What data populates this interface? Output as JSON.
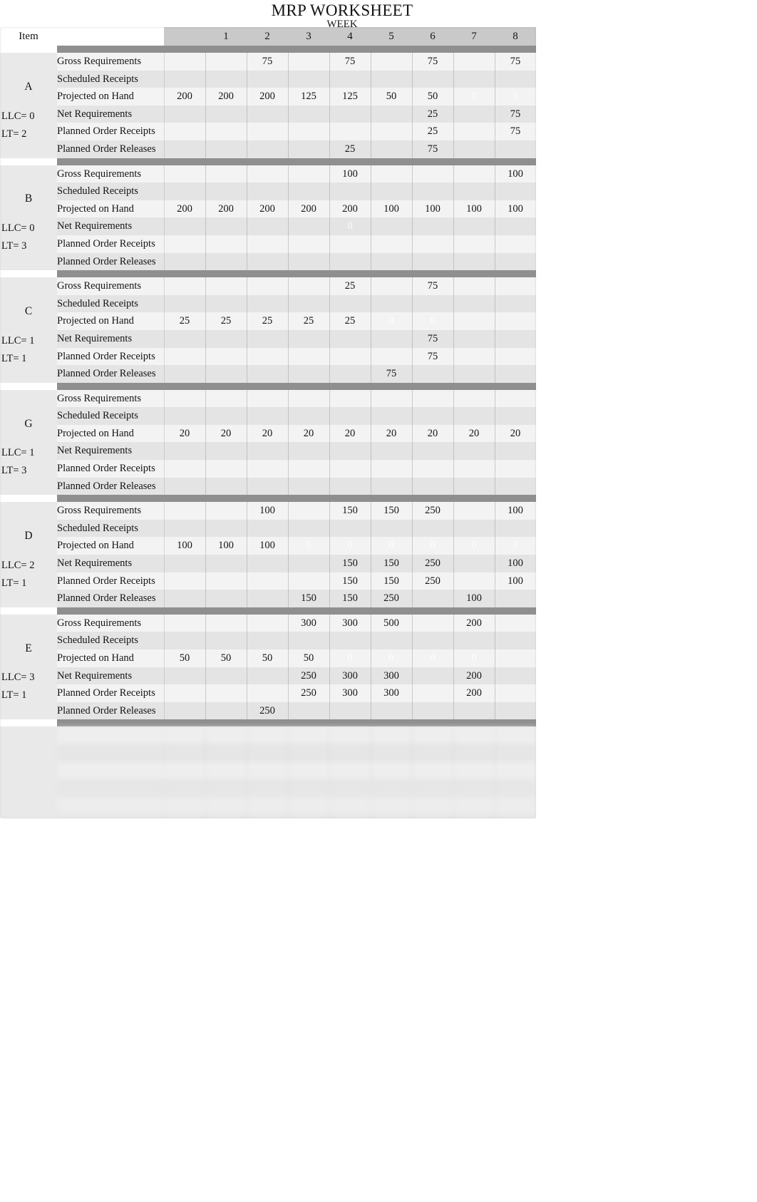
{
  "title": "MRP WORKSHEET",
  "week_label": "WEEK",
  "item_header": "Item",
  "week_columns": [
    "1",
    "2",
    "3",
    "4",
    "5",
    "6",
    "7",
    "8"
  ],
  "row_labels": [
    "Gross Requirements",
    "Scheduled Receipts",
    "Projected on Hand",
    "Net Requirements",
    "Planned Order Receipts",
    "Planned Order Releases"
  ],
  "blocks": [
    {
      "item": "A",
      "llc": "LLC= 0",
      "lt": "LT= 2",
      "rows": [
        {
          "label": "Gross Requirements",
          "onhand": "",
          "weeks": [
            "",
            "75",
            "",
            "75",
            "",
            "75",
            "",
            "75"
          ]
        },
        {
          "label": "Scheduled Receipts",
          "onhand": "",
          "weeks": [
            "",
            "",
            "",
            "",
            "",
            "",
            "",
            ""
          ]
        },
        {
          "label": "Projected on Hand",
          "onhand": "200",
          "weeks": [
            "200",
            "200",
            "125",
            "125",
            "50",
            "50",
            "0",
            "0"
          ]
        },
        {
          "label": "Net Requirements",
          "onhand": "",
          "weeks": [
            "",
            "",
            "",
            "",
            "",
            "25",
            "",
            "75"
          ]
        },
        {
          "label": "Planned Order Receipts",
          "onhand": "",
          "weeks": [
            "",
            "",
            "",
            "",
            "",
            "25",
            "",
            "75"
          ]
        },
        {
          "label": "Planned Order Releases",
          "onhand": "",
          "weeks": [
            "",
            "",
            "",
            "25",
            "",
            "75",
            "",
            ""
          ]
        }
      ]
    },
    {
      "item": "B",
      "llc": "LLC= 0",
      "lt": "LT= 3",
      "rows": [
        {
          "label": "Gross Requirements",
          "onhand": "",
          "weeks": [
            "",
            "",
            "",
            "100",
            "",
            "",
            "",
            "100"
          ]
        },
        {
          "label": "Scheduled Receipts",
          "onhand": "",
          "weeks": [
            "",
            "",
            "",
            "",
            "",
            "",
            "",
            ""
          ]
        },
        {
          "label": "Projected on Hand",
          "onhand": "200",
          "weeks": [
            "200",
            "200",
            "200",
            "200",
            "100",
            "100",
            "100",
            "100"
          ]
        },
        {
          "label": "Net Requirements",
          "onhand": "",
          "weeks": [
            "",
            "",
            "",
            "0",
            "",
            "",
            "",
            ""
          ]
        },
        {
          "label": "Planned Order Receipts",
          "onhand": "",
          "weeks": [
            "",
            "",
            "",
            "",
            "",
            "",
            "",
            ""
          ]
        },
        {
          "label": "Planned Order Releases",
          "onhand": "",
          "weeks": [
            "",
            "",
            "",
            "",
            "",
            "",
            "",
            ""
          ]
        }
      ]
    },
    {
      "item": "C",
      "llc": "LLC= 1",
      "lt": "LT= 1",
      "rows": [
        {
          "label": "Gross Requirements",
          "onhand": "",
          "weeks": [
            "",
            "",
            "",
            "25",
            "",
            "75",
            "",
            ""
          ]
        },
        {
          "label": "Scheduled Receipts",
          "onhand": "",
          "weeks": [
            "",
            "",
            "",
            "",
            "",
            "",
            "",
            ""
          ]
        },
        {
          "label": "Projected on Hand",
          "onhand": "25",
          "weeks": [
            "25",
            "25",
            "25",
            "25",
            "0",
            "0",
            "",
            ""
          ]
        },
        {
          "label": "Net Requirements",
          "onhand": "",
          "weeks": [
            "",
            "",
            "",
            "",
            "",
            "75",
            "",
            ""
          ]
        },
        {
          "label": "Planned Order Receipts",
          "onhand": "",
          "weeks": [
            "",
            "",
            "",
            "",
            "",
            "75",
            "",
            ""
          ]
        },
        {
          "label": "Planned Order Releases",
          "onhand": "",
          "weeks": [
            "",
            "",
            "",
            "",
            "75",
            "",
            "",
            ""
          ]
        }
      ]
    },
    {
      "item": "G",
      "llc": "LLC= 1",
      "lt": "LT= 3",
      "rows": [
        {
          "label": "Gross Requirements",
          "onhand": "",
          "weeks": [
            "",
            "",
            "",
            "",
            "",
            "",
            "",
            ""
          ]
        },
        {
          "label": "Scheduled Receipts",
          "onhand": "",
          "weeks": [
            "",
            "",
            "",
            "",
            "",
            "",
            "",
            ""
          ]
        },
        {
          "label": "Projected on Hand",
          "onhand": "20",
          "weeks": [
            "20",
            "20",
            "20",
            "20",
            "20",
            "20",
            "20",
            "20"
          ]
        },
        {
          "label": "Net Requirements",
          "onhand": "",
          "weeks": [
            "",
            "",
            "",
            "",
            "",
            "",
            "",
            ""
          ]
        },
        {
          "label": "Planned Order Receipts",
          "onhand": "",
          "weeks": [
            "",
            "",
            "",
            "",
            "",
            "",
            "",
            ""
          ]
        },
        {
          "label": "Planned Order Releases",
          "onhand": "",
          "weeks": [
            "",
            "",
            "",
            "",
            "",
            "",
            "",
            ""
          ]
        }
      ]
    },
    {
      "item": "D",
      "llc": "LLC= 2",
      "lt": "LT= 1",
      "rows": [
        {
          "label": "Gross Requirements",
          "onhand": "",
          "weeks": [
            "",
            "100",
            "",
            "150",
            "150",
            "250",
            "",
            "100"
          ]
        },
        {
          "label": "Scheduled Receipts",
          "onhand": "",
          "weeks": [
            "",
            "",
            "",
            "",
            "",
            "",
            "",
            ""
          ]
        },
        {
          "label": "Projected on Hand",
          "onhand": "100",
          "weeks": [
            "100",
            "100",
            "0",
            "0",
            "0",
            "0",
            "0",
            "0"
          ]
        },
        {
          "label": "Net Requirements",
          "onhand": "",
          "weeks": [
            "",
            "",
            "",
            "150",
            "150",
            "250",
            "",
            "100"
          ]
        },
        {
          "label": "Planned Order Receipts",
          "onhand": "",
          "weeks": [
            "",
            "",
            "",
            "150",
            "150",
            "250",
            "",
            "100"
          ]
        },
        {
          "label": "Planned Order Releases",
          "onhand": "",
          "weeks": [
            "",
            "",
            "150",
            "150",
            "250",
            "",
            "100",
            ""
          ]
        }
      ]
    },
    {
      "item": "E",
      "llc": "LLC= 3",
      "lt": "LT= 1",
      "rows": [
        {
          "label": "Gross Requirements",
          "onhand": "",
          "weeks": [
            "",
            "",
            "300",
            "300",
            "500",
            "",
            "200",
            ""
          ]
        },
        {
          "label": "Scheduled Receipts",
          "onhand": "",
          "weeks": [
            "",
            "",
            "",
            "",
            "",
            "",
            "",
            ""
          ]
        },
        {
          "label": "Projected on Hand",
          "onhand": "50",
          "weeks": [
            "50",
            "50",
            "50",
            "0",
            "0",
            "0",
            "0",
            ""
          ]
        },
        {
          "label": "Net Requirements",
          "onhand": "",
          "weeks": [
            "",
            "",
            "250",
            "300",
            "300",
            "",
            "200",
            ""
          ]
        },
        {
          "label": "Planned Order Receipts",
          "onhand": "",
          "weeks": [
            "",
            "",
            "250",
            "300",
            "300",
            "",
            "200",
            ""
          ]
        },
        {
          "label": "Planned Order Releases",
          "onhand": "",
          "weeks": [
            "",
            "250",
            "",
            "",
            "",
            "",
            "",
            ""
          ]
        }
      ]
    },
    {
      "item": "",
      "llc": "",
      "lt": "",
      "faded": true,
      "rows": [
        {
          "label": "",
          "onhand": "",
          "weeks": [
            "",
            "",
            "",
            "",
            "",
            "",
            "",
            ""
          ]
        },
        {
          "label": "",
          "onhand": "",
          "weeks": [
            "",
            "",
            "",
            "",
            "",
            "",
            "",
            ""
          ]
        },
        {
          "label": "",
          "onhand": "",
          "weeks": [
            "",
            "",
            "",
            "",
            "",
            "",
            "",
            ""
          ]
        },
        {
          "label": "",
          "onhand": "",
          "weeks": [
            "",
            "",
            "",
            "",
            "",
            "",
            "",
            ""
          ]
        },
        {
          "label": "",
          "onhand": "",
          "weeks": [
            "",
            "",
            "",
            "",
            "",
            "",
            "",
            ""
          ]
        },
        {
          "label": "",
          "onhand": "",
          "weeks": [
            "",
            "",
            "",
            "",
            "",
            "",
            "",
            ""
          ]
        }
      ]
    }
  ],
  "colors": {
    "header_band": "#c9c9c9",
    "separator": "#8f8f8f",
    "row_light": "#f3f3f3",
    "row_dark": "#e4e4e4",
    "text": "#141414",
    "zero_text": "#fdfdfd"
  }
}
